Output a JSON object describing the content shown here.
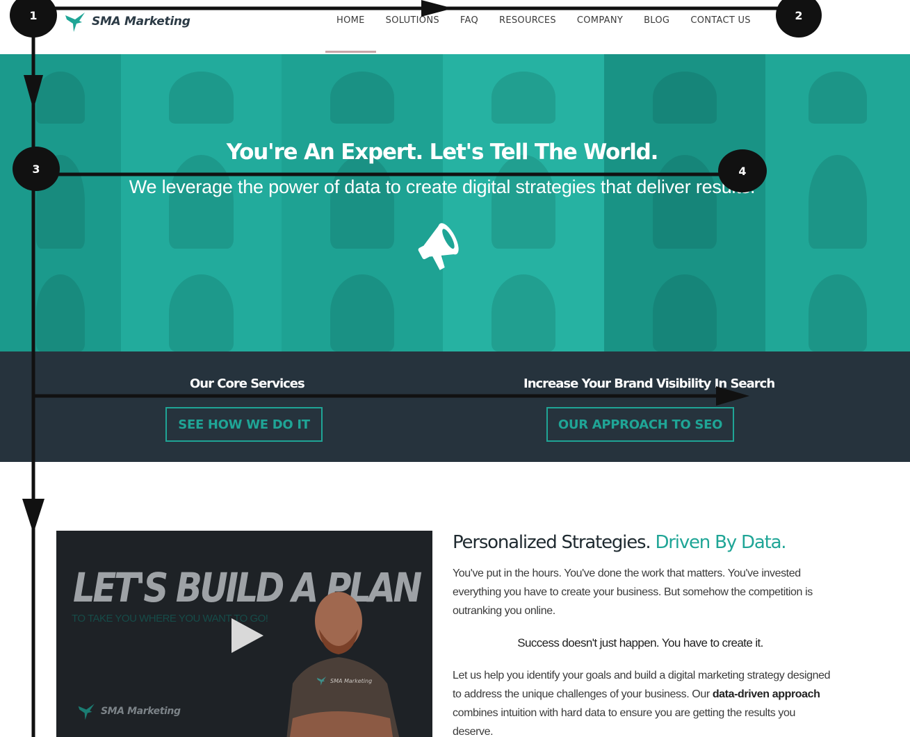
{
  "header": {
    "logo_text": "SMA Marketing",
    "logo_icon": "hummingbird-icon",
    "nav": [
      {
        "label": "HOME"
      },
      {
        "label": "SOLUTIONS"
      },
      {
        "label": "FAQ"
      },
      {
        "label": "RESOURCES"
      },
      {
        "label": "COMPANY"
      },
      {
        "label": "BLOG"
      },
      {
        "label": "CONTACT US"
      }
    ]
  },
  "hero": {
    "title": "You're An Expert. Let's Tell The World.",
    "subtitle": "We leverage the power of data to create digital strategies that deliver results.",
    "icon": "megaphone-icon"
  },
  "cta": {
    "left": {
      "heading": "Our Core Services",
      "button": "SEE HOW WE DO IT"
    },
    "right": {
      "heading": "Increase Your Brand Visibility In Search",
      "button": "OUR APPROACH TO SEO"
    }
  },
  "content": {
    "video": {
      "title": "LET'S BUILD A PLAN",
      "tagline": "TO TAKE YOU WHERE YOU WANT TO GO!",
      "logo_text": "SMA Marketing",
      "shirt_logo_text": "SMA Marketing",
      "play_icon": "play-icon"
    },
    "heading_main": "Personalized Strategies. ",
    "heading_accent": "Driven By Data.",
    "para1": "You've put in the hours. You've done the work that matters. You've invested everything you have to create your business. But somehow the competition is outranking you online.",
    "center_line": "Success doesn't just happen. You have to create it.",
    "para2_start": "Let us help you  identify your goals and build a digital marketing strategy designed to address the unique challenges of your business. Our ",
    "para2_bold": "data-driven approach",
    "para2_end": " combines intuition with hard data to ensure you are getting the results you deserve."
  },
  "annotations": {
    "markers": [
      {
        "label": "1"
      },
      {
        "label": "2"
      },
      {
        "label": "3"
      },
      {
        "label": "4"
      }
    ]
  },
  "colors": {
    "brand_teal": "#1fa596",
    "dark_band": "#26333d",
    "annotation": "#111111"
  }
}
